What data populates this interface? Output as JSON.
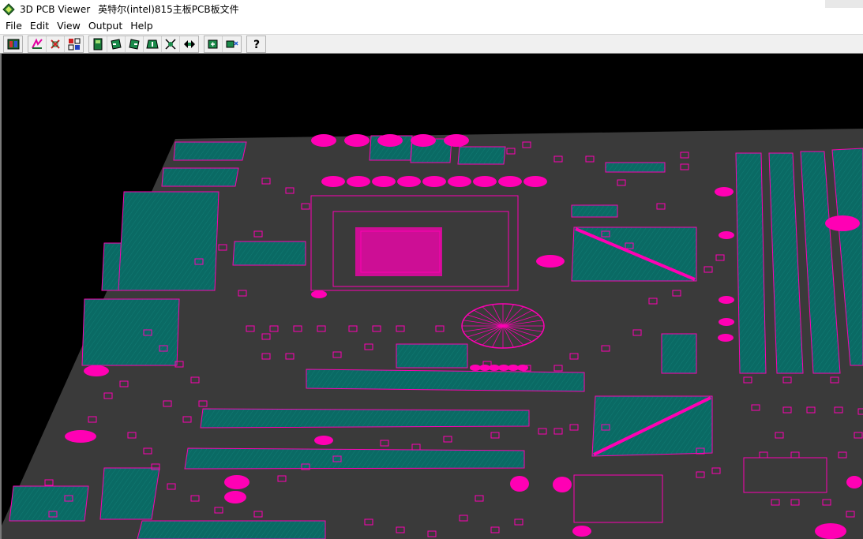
{
  "window": {
    "app_name": "3D PCB Viewer",
    "document_title": "英特尔(intel)815主板PCB板文件"
  },
  "menu": [
    "File",
    "Edit",
    "View",
    "Output",
    "Help"
  ],
  "toolbar": {
    "groups": [
      [
        "open-board-icon"
      ],
      [
        "layer-edit-icon",
        "select-part-icon",
        "number-grid-icon"
      ],
      [
        "view-top-icon",
        "rotate-left-icon",
        "rotate-right-icon",
        "rotate-down-icon",
        "pan-icon",
        "zoom-fit-icon"
      ],
      [
        "zoom-in-icon",
        "zoom-out-icon"
      ],
      [
        "help-icon"
      ]
    ],
    "help_glyph": "?"
  },
  "colors": {
    "board": "#3a3a3a",
    "copper": "#ff00b4",
    "component": "#0a6a64",
    "background": "#000000"
  }
}
